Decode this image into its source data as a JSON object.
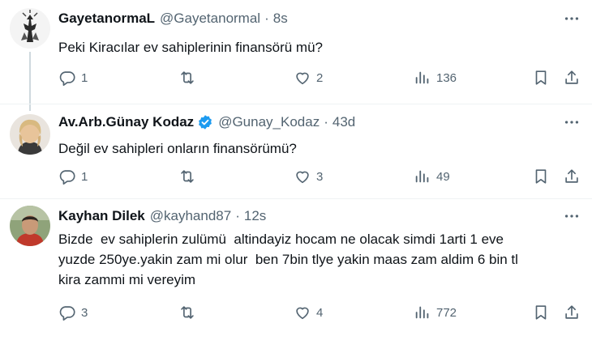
{
  "tweets": [
    {
      "name": "GayetanormaL",
      "handle": "@Gayetanormal",
      "separator": "·",
      "time": "8s",
      "verified": false,
      "text": "Peki Kiracılar ev sahiplerinin finansörü mü?",
      "replies": "1",
      "retweets": "",
      "likes": "2",
      "views": "136"
    },
    {
      "name": "Av.Arb.Günay Kodaz",
      "handle": "@Gunay_Kodaz",
      "separator": "·",
      "time": "43d",
      "verified": true,
      "text": "Değil ev sahipleri onların finansörümü?",
      "replies": "1",
      "retweets": "",
      "likes": "3",
      "views": "49"
    },
    {
      "name": "Kayhan Dilek",
      "handle": "@kayhand87",
      "separator": "·",
      "time": "12s",
      "verified": false,
      "text_lines": [
        "Bizde  ev sahiplerin zulümü  altindayiz hocam ne olacak simdi 1arti 1 eve",
        "yuzde 250ye.yakin zam mi olur  ben 7bin tlye yakin maas zam aldim 6 bin tl",
        "kira zammi mi vereyim"
      ],
      "replies": "3",
      "retweets": "",
      "likes": "4",
      "views": "772"
    }
  ],
  "icons": {
    "reply": "reply-icon",
    "retweet": "retweet-icon",
    "like": "heart-icon",
    "views": "views-icon",
    "bookmark": "bookmark-icon",
    "share": "share-icon",
    "more": "more-icon",
    "verified": "verified-badge-icon"
  },
  "colors": {
    "text": "#0f1419",
    "secondary": "#536471",
    "verified": "#1d9bf0",
    "thread_line": "#cfd9de"
  }
}
